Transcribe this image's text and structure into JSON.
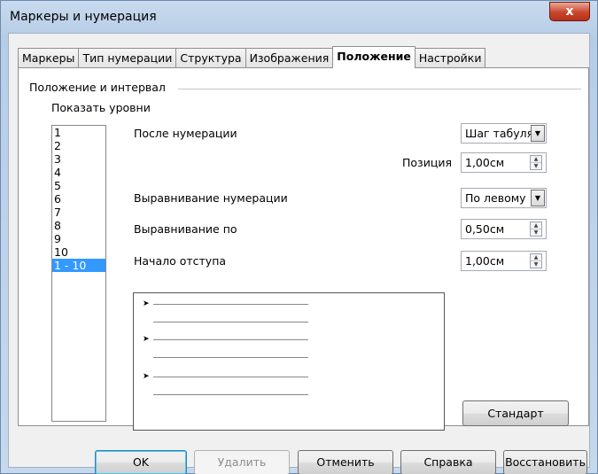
{
  "window": {
    "title": "Маркеры и нумерация",
    "close_label": "x"
  },
  "tabs": [
    "Маркеры",
    "Тип нумерации",
    "Структура",
    "Изображения",
    "Положение",
    "Настройки"
  ],
  "active_tab": "Положение",
  "group": {
    "title": "Положение и интервал"
  },
  "levels": {
    "label": "Показать уровни",
    "items": [
      "1",
      "2",
      "3",
      "4",
      "5",
      "6",
      "7",
      "8",
      "9",
      "10",
      "1 - 10"
    ],
    "selected": "1 - 10"
  },
  "fields": {
    "after_numbering": {
      "label": "После нумерации",
      "value": "Шаг табуля"
    },
    "position": {
      "label": "Позиция",
      "value": "1,00см"
    },
    "numbering_alignment": {
      "label": "Выравнивание нумерации",
      "value": "По левому"
    },
    "align_at": {
      "label": "Выравнивание по",
      "value": "0,50см"
    },
    "indent_start": {
      "label": "Начало отступа",
      "value": "1,00см"
    }
  },
  "preview": {
    "bullet": "➤"
  },
  "buttons": {
    "standard": "Стандарт",
    "ok": "OK",
    "delete": "Удалить",
    "cancel": "Отменить",
    "help": "Справка",
    "restore": "Восстановить"
  },
  "colors": {
    "selection": "#3399ff",
    "titlebar": "#c8daee",
    "close": "#c9462c"
  }
}
